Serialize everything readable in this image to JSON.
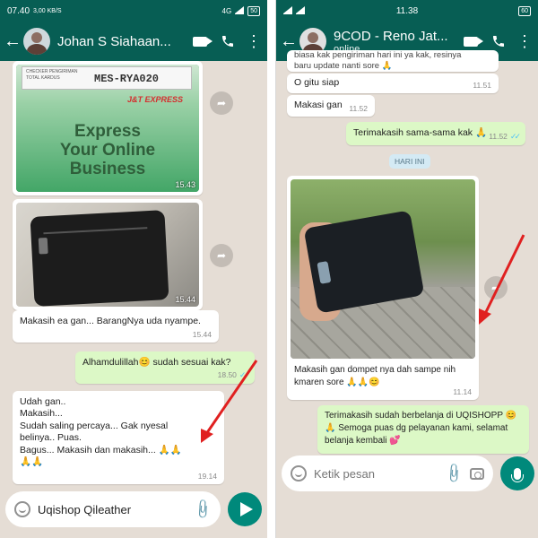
{
  "left": {
    "status": {
      "time": "07.40",
      "signal": "4G",
      "net_speed": "3,00 KB/S",
      "battery": "50"
    },
    "header": {
      "contact_name": "Johan S Siahaan..."
    },
    "images": [
      {
        "label_title": "MES-RYA020",
        "label_small": "CHECKER PENGIRIMAN",
        "label_small2": "TOTAL KARDUS",
        "brand": "J&T EXPRESS",
        "text_line1": "Express",
        "text_line2": "Your Online",
        "text_line3": "Business",
        "time": "15.43"
      },
      {
        "time": "15.44"
      }
    ],
    "messages": [
      {
        "text": "Makasih ea gan...  BarangNya uda nyampe.",
        "time": "15.44"
      },
      {
        "text": "Alhamdulillah😊 sudah sesuai kak?",
        "time": "18.50"
      },
      {
        "lines": [
          "Udah gan..",
          "Makasih...",
          "Sudah saling percaya...  Gak nyesal",
          "belinya..  Puas.",
          "Bagus...  Makasih dan makasih... 🙏🙏",
          "🙏🙏"
        ],
        "time": "19.14"
      }
    ],
    "input": {
      "value": "Uqishop Qileather"
    }
  },
  "right": {
    "status": {
      "time": "11.38",
      "battery": "60"
    },
    "header": {
      "contact_name": "9COD - Reno Jat...",
      "status": "online"
    },
    "messages": [
      {
        "text_line1": "biasa kak pengiriman hari ini ya kak, resinya",
        "text_line2": "baru update nanti sore 🙏",
        "time": ""
      },
      {
        "text": "O gitu siap",
        "time": "11.51"
      },
      {
        "text": "Makasi gan",
        "time": "11.52"
      },
      {
        "text": "Terimakasih sama-sama kak 🙏",
        "time": "11.52"
      },
      {
        "caption_line1": "Makasih gan dompet nya dah sampe nih",
        "caption_line2": "kmaren sore 🙏🙏😊",
        "time": "11.14"
      },
      {
        "lines": [
          "Terimakasih sudah berbelanja di UQISHOPP 😊",
          "🙏 Semoga puas dg pelayanan kami, selamat",
          "belanja kembali 💕"
        ],
        "time": ""
      }
    ],
    "date_chip": "HARI INI",
    "input": {
      "placeholder": "Ketik pesan"
    }
  },
  "colors": {
    "header": "#075e54",
    "outgoing": "#dcf8c6",
    "incoming": "#ffffff",
    "wallpaper": "#e5ddd5",
    "accent": "#00897b",
    "arrow": "#e02020"
  },
  "icons": [
    "back-arrow-icon",
    "video-call-icon",
    "phone-icon",
    "more-icon",
    "forward-icon",
    "emoji-icon",
    "attach-icon",
    "camera-icon",
    "send-icon",
    "mic-icon"
  ]
}
